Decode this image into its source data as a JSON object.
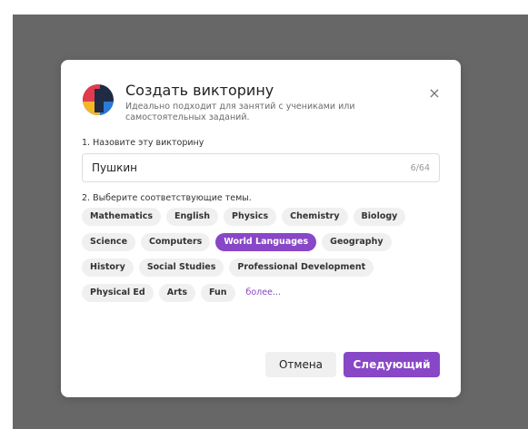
{
  "modal": {
    "title": "Создать викторину",
    "subtitle": "Идеально подходит для занятий с учениками или самостоятельных заданий.",
    "close_icon": "×"
  },
  "name_field": {
    "label": "1. Назовите эту викторину",
    "value": "Пушкин",
    "counter": "6/64"
  },
  "topics": {
    "label": "2. Выберите соответствующие темы.",
    "items": [
      {
        "label": "Mathematics",
        "selected": false
      },
      {
        "label": "English",
        "selected": false
      },
      {
        "label": "Physics",
        "selected": false
      },
      {
        "label": "Chemistry",
        "selected": false
      },
      {
        "label": "Biology",
        "selected": false
      },
      {
        "label": "Science",
        "selected": false
      },
      {
        "label": "Computers",
        "selected": false
      },
      {
        "label": "World Languages",
        "selected": true
      },
      {
        "label": "Geography",
        "selected": false
      },
      {
        "label": "History",
        "selected": false
      },
      {
        "label": "Social Studies",
        "selected": false
      },
      {
        "label": "Professional Development",
        "selected": false
      },
      {
        "label": "Physical Ed",
        "selected": false
      },
      {
        "label": "Arts",
        "selected": false
      },
      {
        "label": "Fun",
        "selected": false
      }
    ],
    "more_label": "более..."
  },
  "footer": {
    "cancel_label": "Отмена",
    "next_label": "Следующий"
  },
  "colors": {
    "accent": "#8847c7",
    "backdrop": "#676767"
  }
}
